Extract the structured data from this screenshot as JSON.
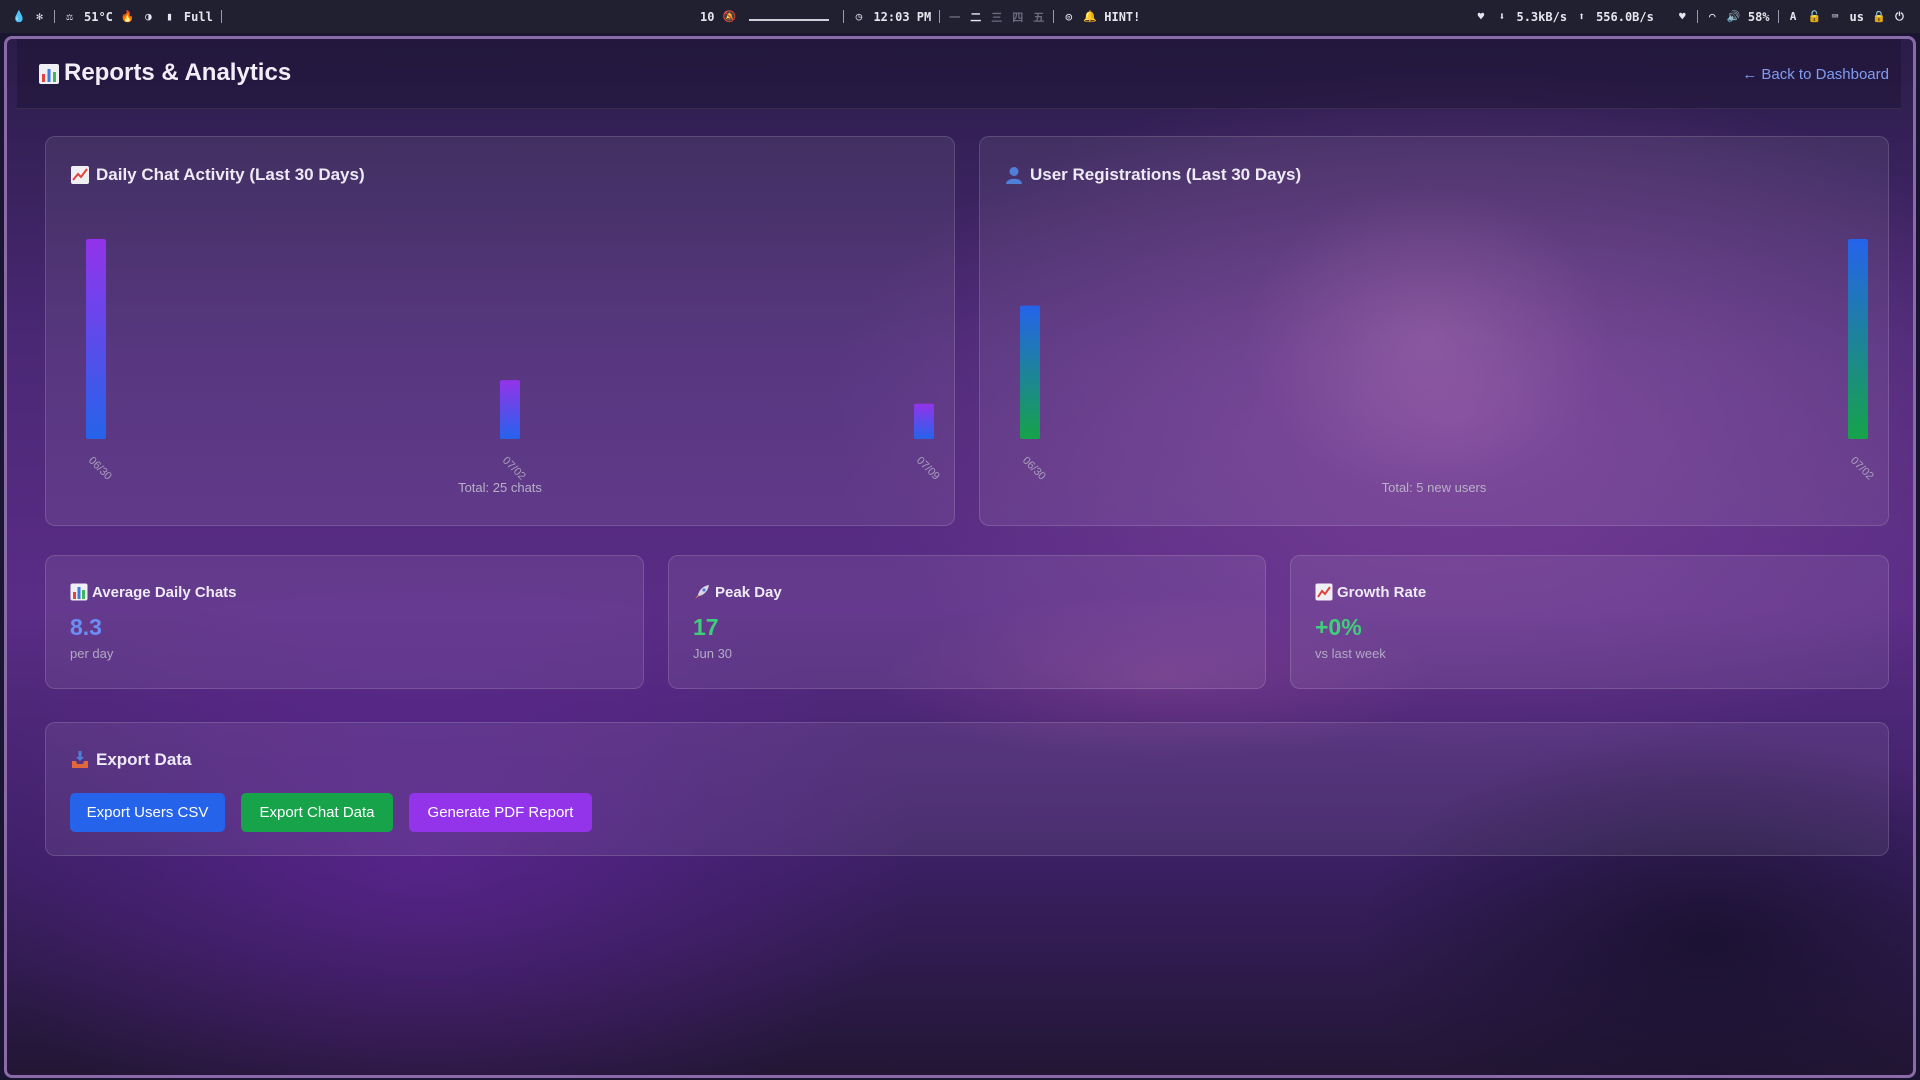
{
  "topbar": {
    "temperature": "51°C",
    "battery_state": "Full",
    "workspace_count": "10",
    "clock": "12:03 PM",
    "hint": "HINT!",
    "net_down": "5.3kB/s",
    "net_up": "556.0B/s",
    "volume": "58%",
    "keyboard_layout": "us"
  },
  "header": {
    "title": "Reports & Analytics",
    "back_link": "← Back to Dashboard"
  },
  "charts": {
    "chat": {
      "title": "Daily Chat Activity (Last 30 Days)",
      "total": "Total: 25 chats"
    },
    "users": {
      "title": "User Registrations (Last 30 Days)",
      "total": "Total: 5 new users"
    }
  },
  "stats": {
    "avg": {
      "title": "Average Daily Chats",
      "value": "8.3",
      "sub": "per day"
    },
    "peak": {
      "title": "Peak Day",
      "value": "17",
      "sub": "Jun 30"
    },
    "growth": {
      "title": "Growth Rate",
      "value": "+0%",
      "sub": "vs last week"
    }
  },
  "export": {
    "title": "Export Data",
    "buttons": {
      "users_csv": "Export Users CSV",
      "chat_data": "Export Chat Data",
      "pdf_report": "Generate PDF Report"
    }
  },
  "colors": {
    "accent_blue": "#2563eb",
    "accent_green": "#16a34a",
    "accent_purple": "#9333ea",
    "stat_blue": "#6b8ef5",
    "stat_green": "#3fcf7a",
    "link": "#7f9df0"
  },
  "chart_data": [
    {
      "type": "bar",
      "title": "Daily Chat Activity (Last 30 Days)",
      "categories": [
        "06/30",
        "07/02",
        "07/09"
      ],
      "values": [
        17,
        5,
        3
      ],
      "ylim": [
        0,
        17
      ]
    },
    {
      "type": "bar",
      "title": "User Registrations (Last 30 Days)",
      "categories": [
        "06/30",
        "07/02"
      ],
      "values": [
        2,
        3
      ],
      "ylim": [
        0,
        3
      ]
    }
  ]
}
